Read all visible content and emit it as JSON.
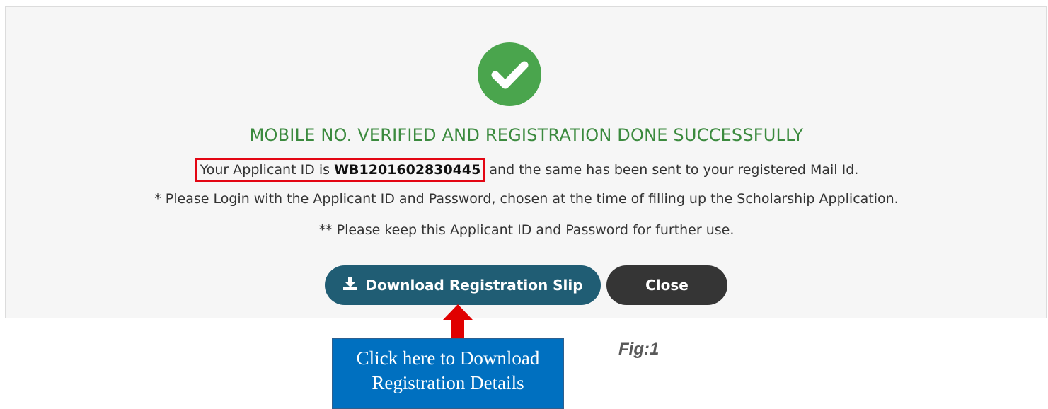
{
  "dialog": {
    "status_icon": "check-circle-icon",
    "title": "MOBILE NO. VERIFIED AND REGISTRATION DONE SUCCESSFULLY",
    "applicant_prefix": "Your Applicant ID is ",
    "applicant_id": "WB1201602830445",
    "applicant_suffix": " and the same has been sent to your registered Mail Id.",
    "note1": "* Please Login with the Applicant ID and Password, chosen at the time of filling up the Scholarship Application.",
    "note2": "** Please keep this Applicant ID and Password for further use.",
    "download_label": "Download Registration Slip",
    "download_icon": "download-icon",
    "close_label": "Close"
  },
  "annotation": {
    "callout_text": "Click here to Download Registration Details",
    "arrow_icon": "red-up-arrow",
    "figure_label": "Fig:1",
    "highlight_color": "#e30613",
    "callout_color": "#0070c0"
  }
}
